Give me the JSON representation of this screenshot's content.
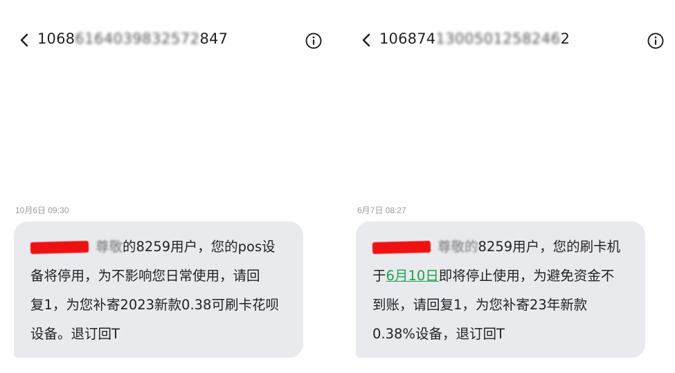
{
  "left": {
    "sender_prefix": "1068",
    "sender_obscured": "6164039832572",
    "sender_suffix": "847",
    "timestamp": "10月6日 09:30",
    "message": {
      "greeting_obscured": "尊敬",
      "line1": "的8259用户，您的pos设",
      "line2": "备将停用，为不影响您日常使用，请回",
      "line3": "复1，为您补寄2023新款0.38可刷卡花呗",
      "line4": "设备。退订回T"
    }
  },
  "right": {
    "sender_prefix": "106874",
    "sender_obscured": "1300501258246",
    "sender_suffix": "2",
    "timestamp": "6月7日 08:27",
    "message": {
      "greeting_obscured": "尊敬的",
      "line1_tail": "8259用户，您的刷卡机",
      "line2_prefix": "于",
      "line2_date": "6月10日",
      "line2_tail": "即将停止使用，为避免资金不",
      "line3": "到账，请回复1，为您补寄23年新款",
      "line4": "0.38%设备，退订回T"
    }
  },
  "icons": {
    "back": "chevron-left-icon",
    "info": "info-circle-icon"
  },
  "colors": {
    "bubble": "#e9eaee",
    "redaction": "#ee1111",
    "link": "#1aa34a",
    "timestamp": "#9a9a9a"
  }
}
